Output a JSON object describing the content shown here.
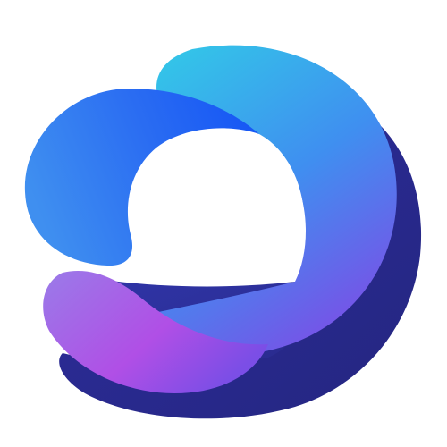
{
  "logo": {
    "icon": "abstract-swirl-logo-icon",
    "colors": {
      "background": "#ffffff",
      "cyan": "#33c6e8",
      "sky_blue": "#3f8ff0",
      "royal_blue": "#1556f5",
      "indigo": "#2e2d9e",
      "deep_indigo": "#242680",
      "violet": "#7b4ee6",
      "magenta": "#b04fe6",
      "lavender": "#9a7be8"
    }
  }
}
